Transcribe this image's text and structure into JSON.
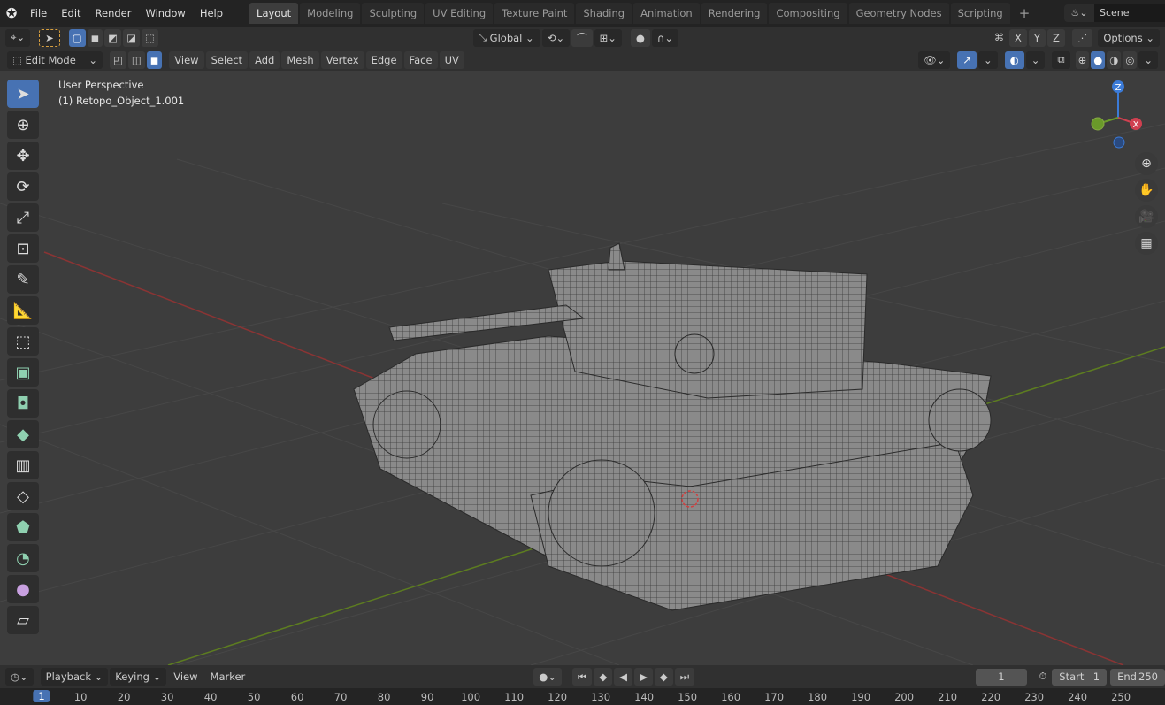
{
  "menu": [
    "File",
    "Edit",
    "Render",
    "Window",
    "Help"
  ],
  "workspaces": [
    "Layout",
    "Modeling",
    "Sculpting",
    "UV Editing",
    "Texture Paint",
    "Shading",
    "Animation",
    "Rendering",
    "Compositing",
    "Geometry Nodes",
    "Scripting"
  ],
  "active_workspace": "Layout",
  "scene": "Scene",
  "tool_header": {
    "orientation": "Global",
    "axes": [
      "X",
      "Y",
      "Z"
    ],
    "options": "Options"
  },
  "header": {
    "mode": "Edit Mode",
    "menus": [
      "View",
      "Select",
      "Add",
      "Mesh",
      "Vertex",
      "Edge",
      "Face",
      "UV"
    ]
  },
  "viewport": {
    "view_name": "User Perspective",
    "object": "(1) Retopo_Object_1.001",
    "gizmo": {
      "z": "Z",
      "x": "X",
      "y": "Y"
    }
  },
  "timeline": {
    "menus": [
      "Playback",
      "Keying",
      "View",
      "Marker"
    ],
    "current_frame": "1",
    "start_label": "Start",
    "start": "1",
    "end_label": "End",
    "end": "250",
    "ruler": [
      "1",
      "10",
      "20",
      "30",
      "40",
      "50",
      "60",
      "70",
      "80",
      "90",
      "100",
      "110",
      "120",
      "130",
      "140",
      "150",
      "160",
      "170",
      "180",
      "190",
      "200",
      "210",
      "220",
      "230",
      "240",
      "250"
    ]
  },
  "colors": {
    "accent": "#4772b3",
    "x_axis": "#9b3b3b",
    "y_axis": "#6b8e23",
    "viewport_bg": "#3d3d3d"
  }
}
